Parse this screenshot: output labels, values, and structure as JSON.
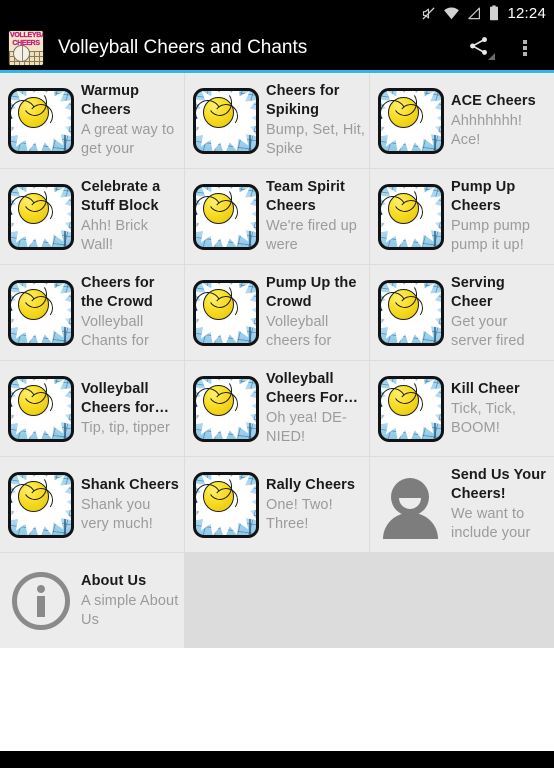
{
  "statusbar": {
    "time": "12:24",
    "icons": [
      "mute-icon",
      "wifi-icon",
      "signal-icon",
      "battery-icon"
    ]
  },
  "actionbar": {
    "logo_text": "VOLLEYBALL CHEERS",
    "title": "Volleyball Cheers and Chants",
    "share_label": "Share",
    "overflow_label": "More options",
    "accent_color": "#33b5e5"
  },
  "colors": {
    "cell_background": "#ececec",
    "grid_background": "#dcdcdc",
    "title_text": "#1a1a1a",
    "subtitle_text": "#9b9b9b",
    "ball_yellow": "#f7dc22",
    "court_blue": "#9ed3f0"
  },
  "grid": {
    "items": [
      {
        "title": "Warmup Cheers",
        "subtitle": "A great way to get your",
        "icon": "volleyball-icon"
      },
      {
        "title": "Cheers for Spiking",
        "subtitle": "Bump, Set, Hit, Spike",
        "icon": "volleyball-icon"
      },
      {
        "title": "ACE Cheers",
        "subtitle": "Ahhhhhhh! Ace!",
        "icon": "volleyball-icon"
      },
      {
        "title": "Celebrate a Stuff Block",
        "subtitle": "Ahh! Brick Wall!",
        "icon": "volleyball-icon"
      },
      {
        "title": "Team Spirit Cheers",
        "subtitle": "We're fired up were",
        "icon": "volleyball-icon"
      },
      {
        "title": "Pump Up Cheers",
        "subtitle": "Pump pump pump it up!",
        "icon": "volleyball-icon"
      },
      {
        "title": "Cheers for the Crowd",
        "subtitle": "Volleyball Chants for",
        "icon": "volleyball-icon"
      },
      {
        "title": "Pump Up the Crowd",
        "subtitle": "Volleyball cheers for",
        "icon": "volleyball-icon"
      },
      {
        "title": "Serving Cheer",
        "subtitle": "Get your server fired",
        "icon": "volleyball-icon"
      },
      {
        "title": "Volleyball Cheers for…",
        "subtitle": "Tip, tip, tipper",
        "icon": "volleyball-icon"
      },
      {
        "title": "Volleyball Cheers For…",
        "subtitle": "Oh yea! DE-NIED!",
        "icon": "volleyball-icon"
      },
      {
        "title": "Kill Cheer",
        "subtitle": "Tick, Tick, BOOM!",
        "icon": "volleyball-icon"
      },
      {
        "title": "Shank Cheers",
        "subtitle": "Shank you very much!",
        "icon": "volleyball-icon"
      },
      {
        "title": "Rally Cheers",
        "subtitle": "One! Two! Three!",
        "icon": "volleyball-icon"
      },
      {
        "title": "Send Us Your Cheers!",
        "subtitle": "We want to include your",
        "icon": "person-icon"
      },
      {
        "title": "About Us",
        "subtitle": "A simple About Us",
        "icon": "info-icon"
      }
    ]
  }
}
